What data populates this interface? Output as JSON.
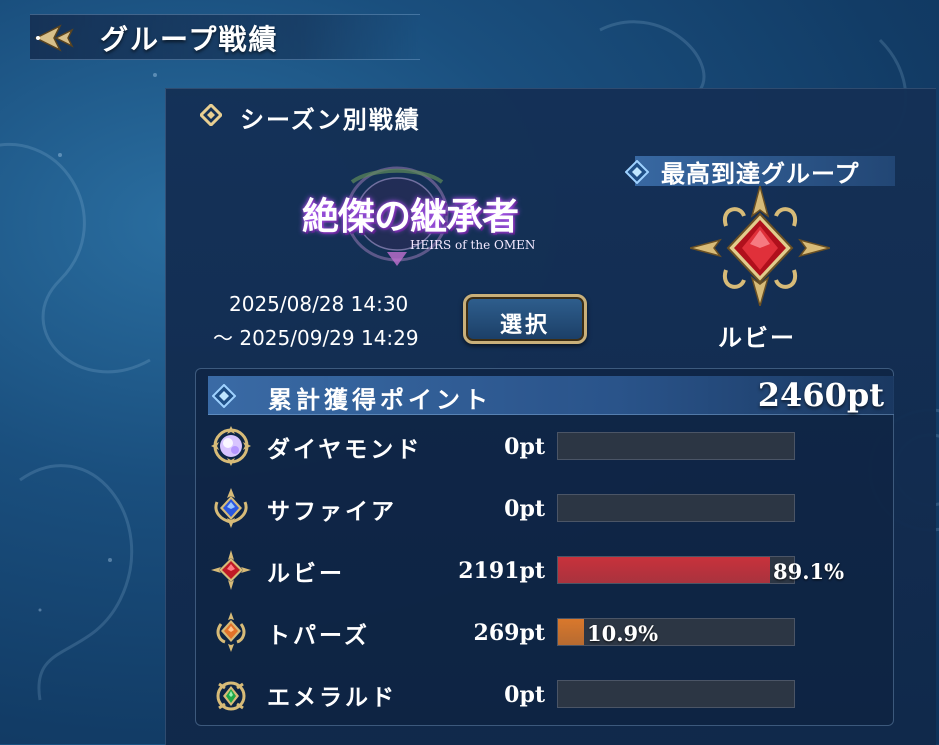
{
  "header": {
    "title": "グループ戦績"
  },
  "season": {
    "section_title": "シーズン別戦績",
    "logo_main": "絶傑の継承者",
    "logo_sub": "HEIRS of the OMEN",
    "date_start": "2025/08/28 14:30",
    "date_end": "～ 2025/09/29 14:29",
    "select_label": "選択"
  },
  "top_group": {
    "label": "最高到達グループ",
    "group": "ルビー"
  },
  "points": {
    "label": "累計獲得ポイント",
    "total": "2460pt",
    "rows": [
      {
        "name": "ダイヤモンド",
        "pts": "0pt",
        "percent": 0,
        "pct_label": "",
        "icon": "diamond-icon",
        "color": "#e8d7ff"
      },
      {
        "name": "サファイア",
        "pts": "0pt",
        "percent": 0,
        "pct_label": "",
        "icon": "sapphire-icon",
        "color": "#3a6bff"
      },
      {
        "name": "ルビー",
        "pts": "2191pt",
        "percent": 89.1,
        "pct_label": "89.1%",
        "icon": "ruby-icon",
        "color": "#c8323c"
      },
      {
        "name": "トパーズ",
        "pts": "269pt",
        "percent": 10.9,
        "pct_label": "10.9%",
        "icon": "topaz-icon",
        "color": "#d9782c"
      },
      {
        "name": "エメラルド",
        "pts": "0pt",
        "percent": 0,
        "pct_label": "",
        "icon": "emerald-icon",
        "color": "#2fbf55"
      }
    ]
  }
}
